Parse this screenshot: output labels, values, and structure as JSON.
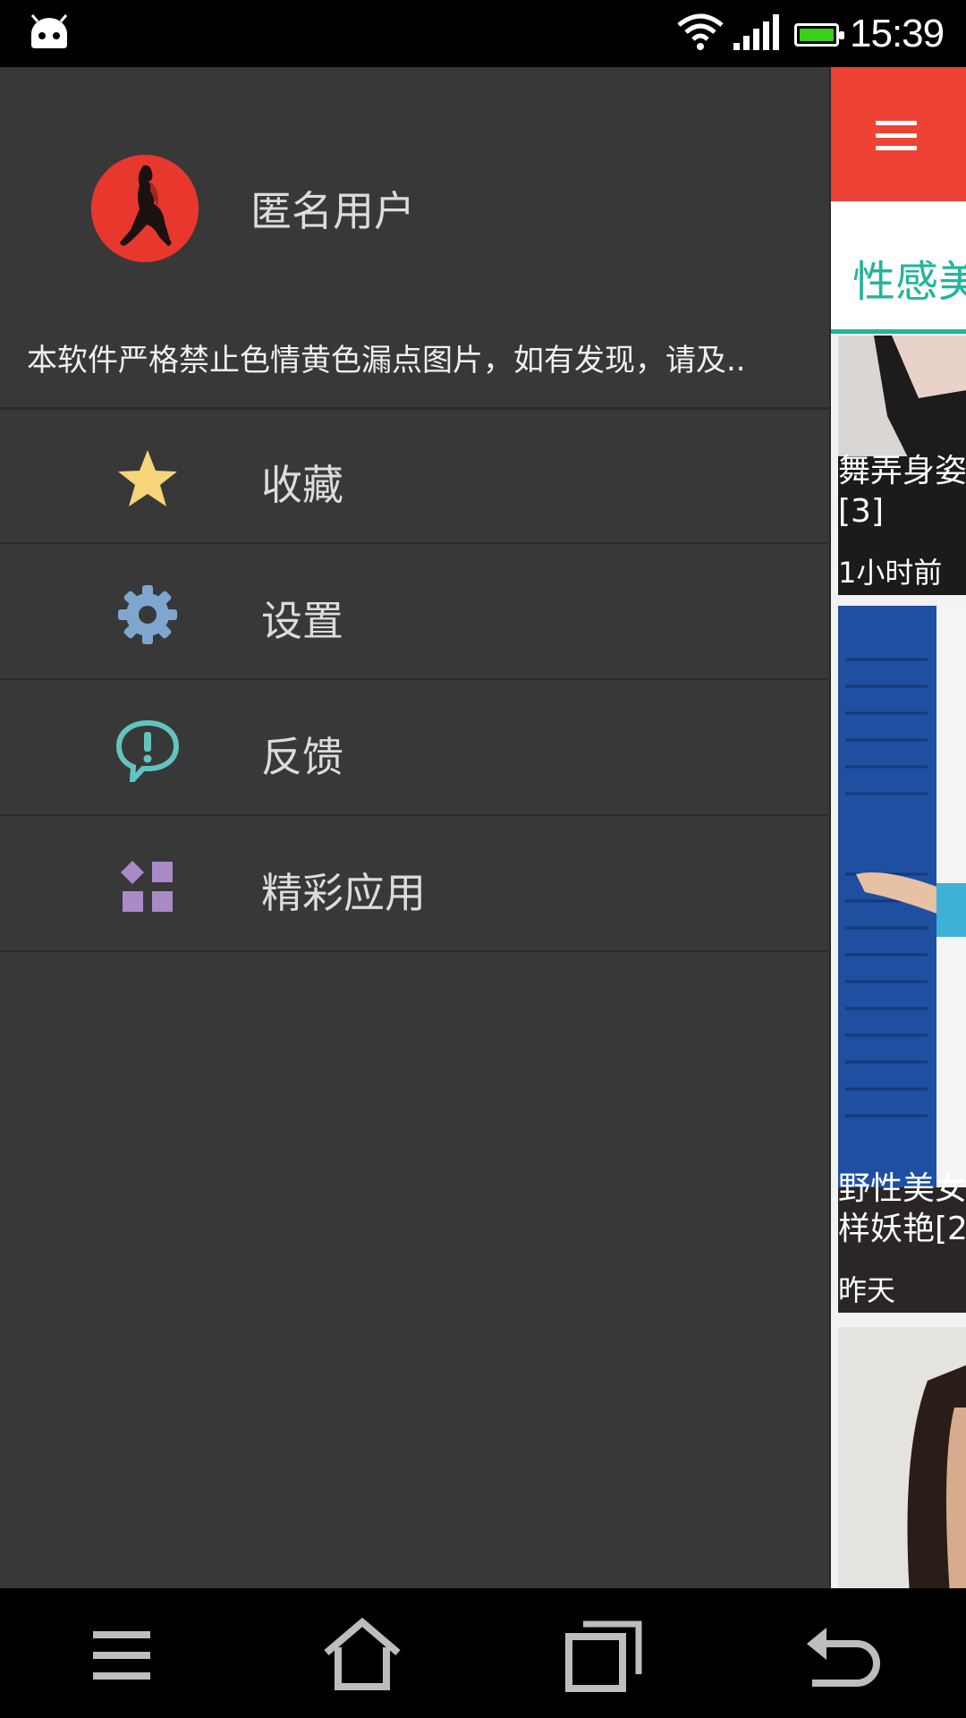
{
  "status_bar": {
    "time": "15:39",
    "icons": [
      "android-icon",
      "wifi-icon",
      "signal-icon",
      "battery-icon"
    ],
    "battery_color": "#3ad01a"
  },
  "drawer": {
    "username": "匿名用户",
    "notice": "本软件严格禁止色情黄色漏点图片，如有发现，请及..",
    "menu": [
      {
        "label": "收藏",
        "icon": "star-icon",
        "color": "#f6d57a"
      },
      {
        "label": "设置",
        "icon": "gear-icon",
        "color": "#7fa6cf"
      },
      {
        "label": "反馈",
        "icon": "feedback-icon",
        "color": "#63c4bf"
      },
      {
        "label": "精彩应用",
        "icon": "apps-icon",
        "color": "#a98ac6"
      }
    ]
  },
  "main": {
    "header_color": "#ee4235",
    "tab_label": "性感美",
    "accent_color": "#20b59a",
    "cards": [
      {
        "caption_line1": "舞弄身姿",
        "caption_line2": "[3]",
        "time": "1小时前"
      },
      {
        "caption_line1": "野性美女",
        "caption_line2": "样妖艳[2",
        "time": "昨天"
      },
      {
        "caption_line1": "",
        "caption_line2": "",
        "time": ""
      }
    ]
  },
  "nav_bar": {
    "buttons": [
      "menu-icon",
      "home-icon",
      "recent-apps-icon",
      "back-icon"
    ]
  }
}
